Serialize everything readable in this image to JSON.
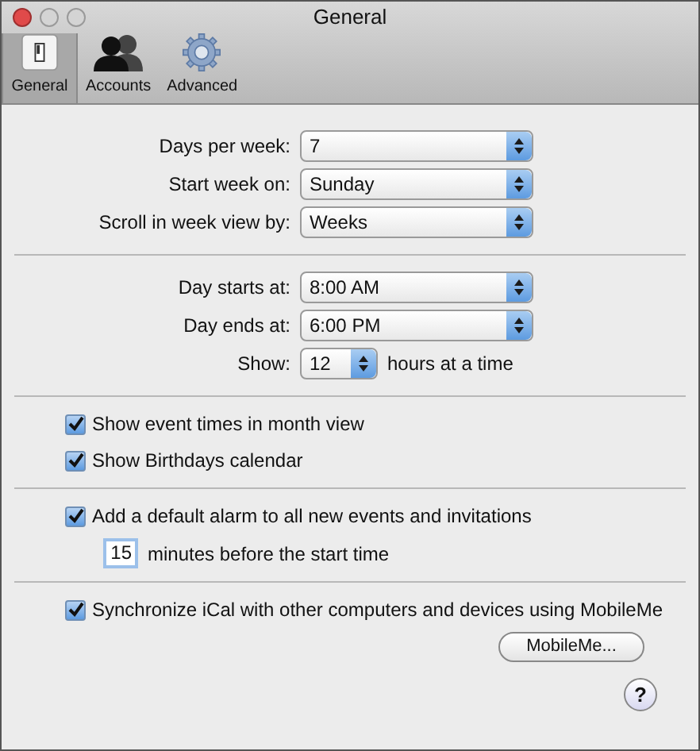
{
  "window": {
    "title": "General"
  },
  "toolbar": [
    {
      "label": "General",
      "kind": "switch",
      "selected": true
    },
    {
      "label": "Accounts",
      "kind": "people",
      "selected": false
    },
    {
      "label": "Advanced",
      "kind": "gear",
      "selected": false
    }
  ],
  "sections": [
    {
      "kind": "popups",
      "rows": [
        {
          "label": "Days per week:",
          "value": "7"
        },
        {
          "label": "Start week on:",
          "value": "Sunday"
        },
        {
          "label": "Scroll in week view by:",
          "value": "Weeks"
        }
      ]
    },
    {
      "kind": "popups",
      "rows": [
        {
          "label": "Day starts at:",
          "value": "8:00 AM"
        },
        {
          "label": "Day ends at:",
          "value": "6:00 PM"
        }
      ],
      "show": {
        "label": "Show:",
        "value": "12",
        "suffix": "hours at a time"
      }
    },
    {
      "kind": "checks",
      "rows": [
        {
          "label": "Show event times in month view",
          "checked": true
        },
        {
          "label": "Show Birthdays calendar",
          "checked": true
        }
      ]
    },
    {
      "kind": "checks",
      "rows": [
        {
          "label": "Add a default alarm to all new events and invitations",
          "checked": true
        }
      ],
      "minutes": {
        "value": "15",
        "suffix": "minutes before the start time"
      }
    },
    {
      "kind": "checks",
      "rows": [
        {
          "label": "Synchronize iCal with other computers and devices using MobileMe",
          "checked": true
        }
      ],
      "button": "MobileMe..."
    }
  ],
  "help": "?"
}
